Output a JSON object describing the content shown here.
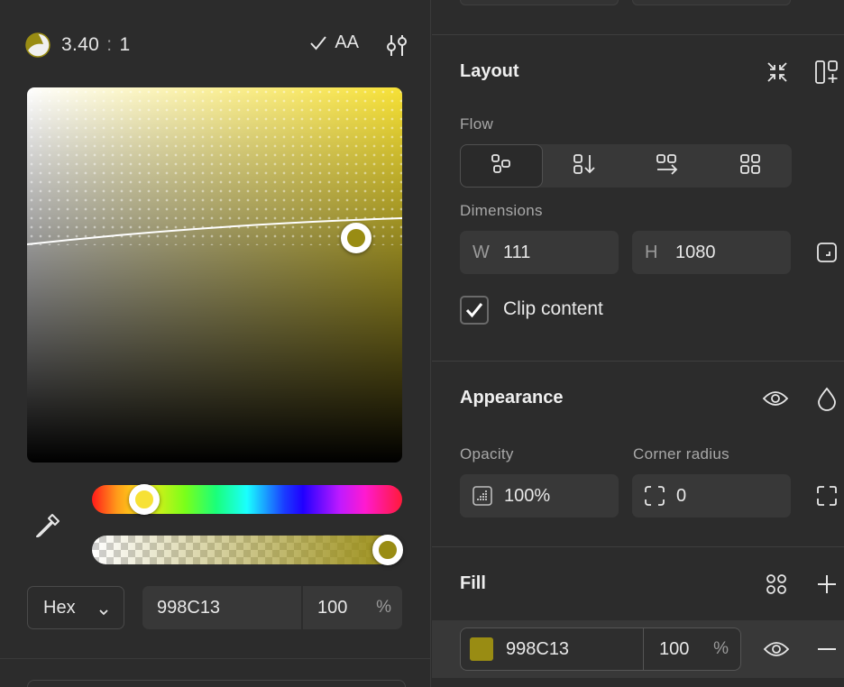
{
  "colors": {
    "current": "#998C13",
    "hue": "#F7E135",
    "panel_bg": "#2c2c2c",
    "field_bg": "#383838"
  },
  "picker": {
    "contrast": {
      "ratio": "3.40",
      "separator": ":",
      "target": "1",
      "icon": "contrast-icon"
    },
    "compliance": {
      "check_icon": "check-icon",
      "label": "AA"
    },
    "settings_icon": "sliders-icon",
    "eyedropper_icon": "eyedropper-icon",
    "hue_percent": 18,
    "alpha_percent": 100,
    "format": {
      "value": "Hex",
      "icon": "chevron-down-icon"
    },
    "hex": "998C13",
    "alpha": "100",
    "alpha_unit": "%"
  },
  "layout": {
    "title": "Layout",
    "actions": [
      "collapse-icon",
      "add-layout-icon"
    ],
    "flow": {
      "label": "Flow",
      "options": [
        "freeform-icon",
        "vertical-flow-icon",
        "horizontal-flow-icon",
        "grid-flow-icon"
      ],
      "active": 0
    },
    "dimensions": {
      "label": "Dimensions",
      "width_prefix": "W",
      "width": "111",
      "height_prefix": "H",
      "height": "1080",
      "resize_icon": "resize-to-fit-icon"
    },
    "clip": {
      "label": "Clip content",
      "checked": true
    }
  },
  "appearance": {
    "title": "Appearance",
    "actions": [
      "eye-icon",
      "drop-icon"
    ],
    "opacity": {
      "label": "Opacity",
      "value": "100%",
      "icon": "opacity-icon"
    },
    "corner_radius": {
      "label": "Corner radius",
      "value": "0",
      "icon": "corner-radius-icon",
      "expand_icon": "independent-corners-icon"
    }
  },
  "fill": {
    "title": "Fill",
    "actions": [
      "styles-icon",
      "plus-icon"
    ],
    "item": {
      "hex": "998C13",
      "alpha": "100",
      "unit": "%",
      "visible_icon": "eye-icon",
      "remove_icon": "minus-icon"
    }
  }
}
